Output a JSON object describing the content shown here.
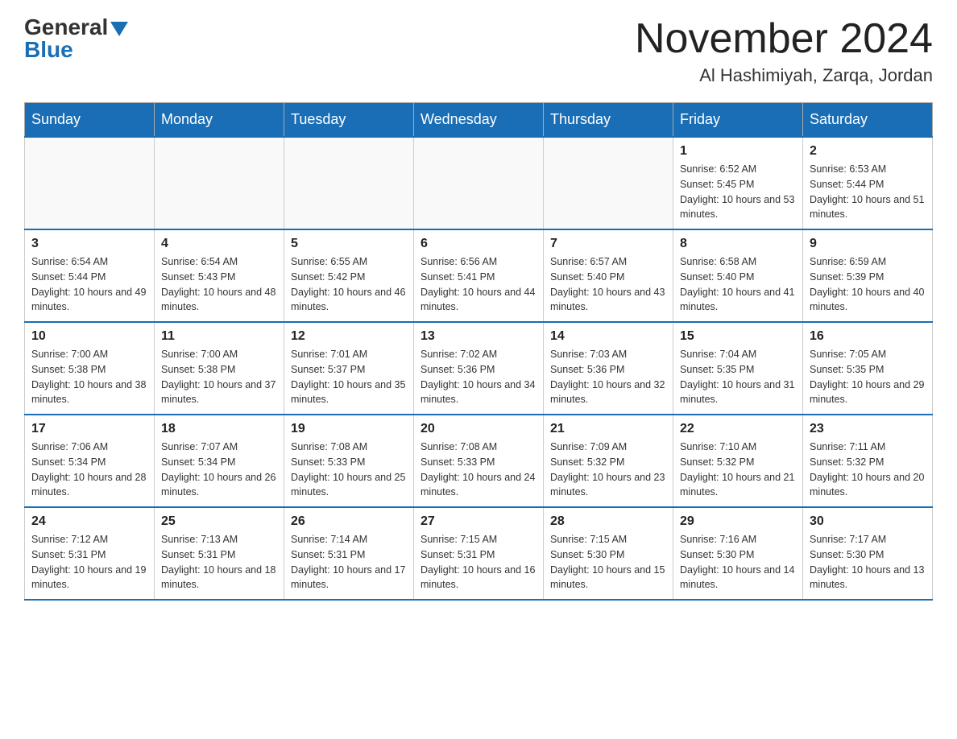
{
  "header": {
    "logo_general": "General",
    "logo_blue": "Blue",
    "month": "November 2024",
    "location": "Al Hashimiyah, Zarqa, Jordan"
  },
  "days_of_week": [
    "Sunday",
    "Monday",
    "Tuesday",
    "Wednesday",
    "Thursday",
    "Friday",
    "Saturday"
  ],
  "weeks": [
    [
      {
        "day": "",
        "info": ""
      },
      {
        "day": "",
        "info": ""
      },
      {
        "day": "",
        "info": ""
      },
      {
        "day": "",
        "info": ""
      },
      {
        "day": "",
        "info": ""
      },
      {
        "day": "1",
        "info": "Sunrise: 6:52 AM\nSunset: 5:45 PM\nDaylight: 10 hours and 53 minutes."
      },
      {
        "day": "2",
        "info": "Sunrise: 6:53 AM\nSunset: 5:44 PM\nDaylight: 10 hours and 51 minutes."
      }
    ],
    [
      {
        "day": "3",
        "info": "Sunrise: 6:54 AM\nSunset: 5:44 PM\nDaylight: 10 hours and 49 minutes."
      },
      {
        "day": "4",
        "info": "Sunrise: 6:54 AM\nSunset: 5:43 PM\nDaylight: 10 hours and 48 minutes."
      },
      {
        "day": "5",
        "info": "Sunrise: 6:55 AM\nSunset: 5:42 PM\nDaylight: 10 hours and 46 minutes."
      },
      {
        "day": "6",
        "info": "Sunrise: 6:56 AM\nSunset: 5:41 PM\nDaylight: 10 hours and 44 minutes."
      },
      {
        "day": "7",
        "info": "Sunrise: 6:57 AM\nSunset: 5:40 PM\nDaylight: 10 hours and 43 minutes."
      },
      {
        "day": "8",
        "info": "Sunrise: 6:58 AM\nSunset: 5:40 PM\nDaylight: 10 hours and 41 minutes."
      },
      {
        "day": "9",
        "info": "Sunrise: 6:59 AM\nSunset: 5:39 PM\nDaylight: 10 hours and 40 minutes."
      }
    ],
    [
      {
        "day": "10",
        "info": "Sunrise: 7:00 AM\nSunset: 5:38 PM\nDaylight: 10 hours and 38 minutes."
      },
      {
        "day": "11",
        "info": "Sunrise: 7:00 AM\nSunset: 5:38 PM\nDaylight: 10 hours and 37 minutes."
      },
      {
        "day": "12",
        "info": "Sunrise: 7:01 AM\nSunset: 5:37 PM\nDaylight: 10 hours and 35 minutes."
      },
      {
        "day": "13",
        "info": "Sunrise: 7:02 AM\nSunset: 5:36 PM\nDaylight: 10 hours and 34 minutes."
      },
      {
        "day": "14",
        "info": "Sunrise: 7:03 AM\nSunset: 5:36 PM\nDaylight: 10 hours and 32 minutes."
      },
      {
        "day": "15",
        "info": "Sunrise: 7:04 AM\nSunset: 5:35 PM\nDaylight: 10 hours and 31 minutes."
      },
      {
        "day": "16",
        "info": "Sunrise: 7:05 AM\nSunset: 5:35 PM\nDaylight: 10 hours and 29 minutes."
      }
    ],
    [
      {
        "day": "17",
        "info": "Sunrise: 7:06 AM\nSunset: 5:34 PM\nDaylight: 10 hours and 28 minutes."
      },
      {
        "day": "18",
        "info": "Sunrise: 7:07 AM\nSunset: 5:34 PM\nDaylight: 10 hours and 26 minutes."
      },
      {
        "day": "19",
        "info": "Sunrise: 7:08 AM\nSunset: 5:33 PM\nDaylight: 10 hours and 25 minutes."
      },
      {
        "day": "20",
        "info": "Sunrise: 7:08 AM\nSunset: 5:33 PM\nDaylight: 10 hours and 24 minutes."
      },
      {
        "day": "21",
        "info": "Sunrise: 7:09 AM\nSunset: 5:32 PM\nDaylight: 10 hours and 23 minutes."
      },
      {
        "day": "22",
        "info": "Sunrise: 7:10 AM\nSunset: 5:32 PM\nDaylight: 10 hours and 21 minutes."
      },
      {
        "day": "23",
        "info": "Sunrise: 7:11 AM\nSunset: 5:32 PM\nDaylight: 10 hours and 20 minutes."
      }
    ],
    [
      {
        "day": "24",
        "info": "Sunrise: 7:12 AM\nSunset: 5:31 PM\nDaylight: 10 hours and 19 minutes."
      },
      {
        "day": "25",
        "info": "Sunrise: 7:13 AM\nSunset: 5:31 PM\nDaylight: 10 hours and 18 minutes."
      },
      {
        "day": "26",
        "info": "Sunrise: 7:14 AM\nSunset: 5:31 PM\nDaylight: 10 hours and 17 minutes."
      },
      {
        "day": "27",
        "info": "Sunrise: 7:15 AM\nSunset: 5:31 PM\nDaylight: 10 hours and 16 minutes."
      },
      {
        "day": "28",
        "info": "Sunrise: 7:15 AM\nSunset: 5:30 PM\nDaylight: 10 hours and 15 minutes."
      },
      {
        "day": "29",
        "info": "Sunrise: 7:16 AM\nSunset: 5:30 PM\nDaylight: 10 hours and 14 minutes."
      },
      {
        "day": "30",
        "info": "Sunrise: 7:17 AM\nSunset: 5:30 PM\nDaylight: 10 hours and 13 minutes."
      }
    ]
  ]
}
